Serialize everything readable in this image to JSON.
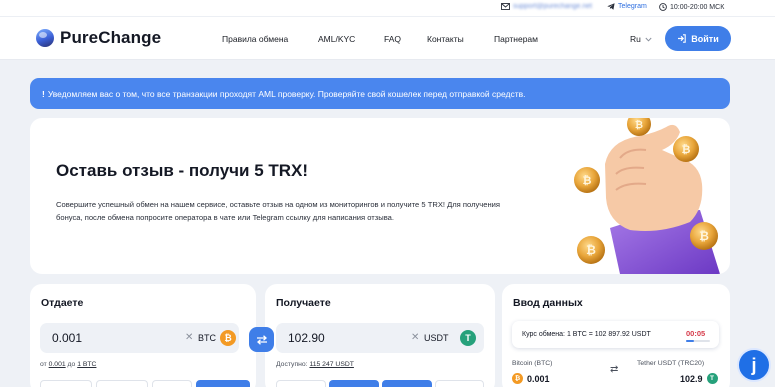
{
  "topbar": {
    "email": "support@purechange.net",
    "telegram": "Telegram",
    "hours": "10:00-20:00 МСК"
  },
  "header": {
    "logo": "PureChange",
    "nav": [
      "Правила обмена",
      "AML/KYC",
      "FAQ",
      "Контакты",
      "Партнерам"
    ],
    "lang": "Ru",
    "login": "Войти"
  },
  "notice": {
    "icon": "!",
    "text": "Уведомляем вас о том, что все транзакции проходят AML проверку. Проверяйте свой кошелек перед отправкой средств."
  },
  "promo": {
    "title": "Оставь отзыв - получи 5 TRX!",
    "text": "Совершите успешный обмен на нашем сервисе, оставьте отзыв на одном из мониторингов и получите 5 TRX! Для получения бонуса, после обмена попросите оператора в чате или Telegram ссылку для написания отзыва."
  },
  "give": {
    "title": "Отдаете",
    "amount": "0.001",
    "currency": "BTC",
    "coin_symbol": "₿",
    "limit_from_label": "от",
    "limit_from": "0.001",
    "limit_to_label": "до",
    "limit_to": "1 BTC"
  },
  "get": {
    "title": "Получаете",
    "amount": "102.90",
    "currency": "USDT",
    "coin_symbol": "T",
    "available_label": "Доступно:",
    "available": "115 247 USDT"
  },
  "data": {
    "title": "Ввод данных",
    "rate": "Курс обмена: 1 BTC = 102 897.92 USDT",
    "timer": "00:05",
    "timer_progress": 0.35,
    "from_name": "Bitcoin (BTC)",
    "to_name": "Tether USDT (TRC20)",
    "from_amount": "0.001",
    "to_amount": "102.9"
  },
  "colors": {
    "accent": "#3f7ee8",
    "notice": "#4a86ee",
    "btc": "#f39a24",
    "usdt": "#26a17b",
    "timer": "#d63b4a",
    "background": "#eef1f6"
  },
  "icons": {
    "email": "envelope-icon",
    "telegram": "telegram-icon",
    "clock": "clock-icon",
    "swap": "swap-arrows-icon",
    "chat": "chat-widget-icon"
  }
}
